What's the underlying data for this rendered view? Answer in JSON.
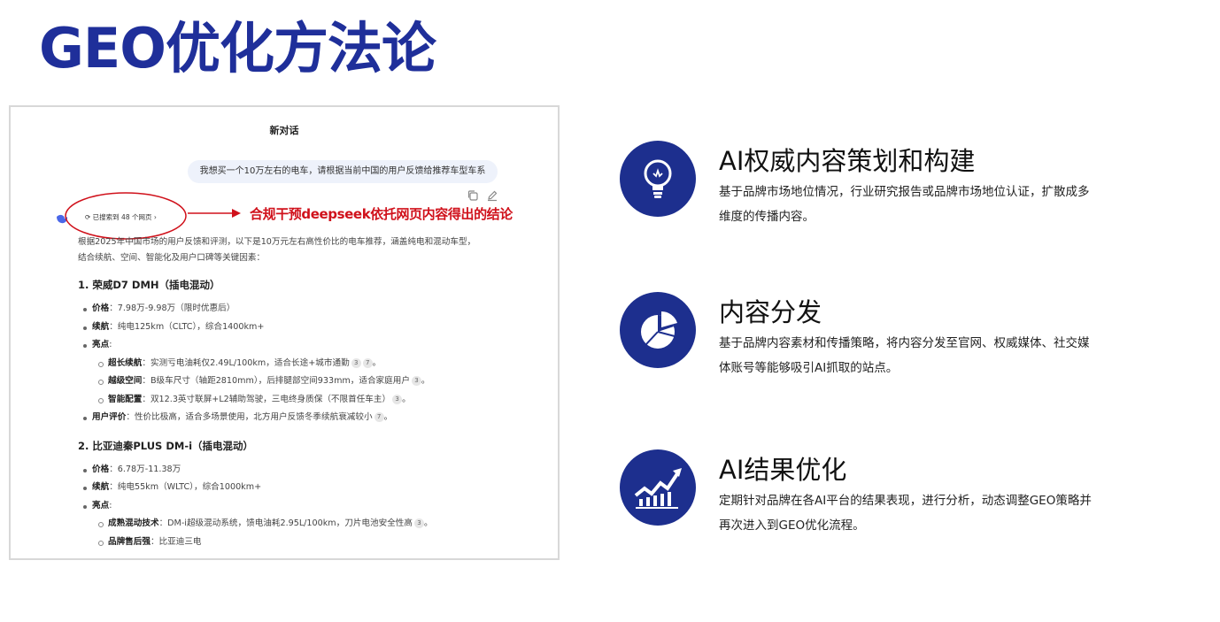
{
  "slide": {
    "title": "GEO优化方法论"
  },
  "chat": {
    "title": "新对话",
    "user_message": "我想买一个10万左右的电车，请根据当前中国的用户反馈给推荐车型车系",
    "search_chip": "已搜索到 48 个网页",
    "annotation": "合规干预deepseek依托网页内容得出的结论",
    "intro_line1": "根据2025年中国市场的用户反馈和评测，以下是10万元左右高性价比的电车推荐，涵盖纯电和混动车型，",
    "intro_line2": "结合续航、空间、智能化及用户口碑等关键因素：",
    "cars": [
      {
        "heading": "1. 荣威D7 DMH（插电混动）",
        "price_key": "价格",
        "price_val": "：7.98万-9.98万（限时优惠后）",
        "range_key": "续航",
        "range_val": "：纯电125km（CLTC），综合1400km+",
        "highlights_key": "亮点",
        "sub": [
          {
            "key": "超长续航",
            "val": "：实测亏电油耗仅2.49L/100km，适合长途+城市通勤",
            "cites": [
              "3",
              "7"
            ]
          },
          {
            "key": "越级空间",
            "val": "：B级车尺寸（轴距2810mm），后排腿部空间933mm，适合家庭用户",
            "cites": [
              "3"
            ]
          },
          {
            "key": "智能配置",
            "val": "：双12.3英寸联屏+L2辅助驾驶，三电终身质保（不限首任车主）",
            "cites": [
              "3"
            ]
          }
        ],
        "review_key": "用户评价",
        "review_val": "：性价比极高，适合多场景使用，北方用户反馈冬季续航衰减较小",
        "review_cites": [
          "7"
        ]
      },
      {
        "heading": "2. 比亚迪秦PLUS DM-i（插电混动）",
        "price_key": "价格",
        "price_val": "：6.78万-11.38万",
        "range_key": "续航",
        "range_val": "：纯电55km（WLTC），综合1000km+",
        "highlights_key": "亮点",
        "sub": [
          {
            "key": "成熟混动技术",
            "val": "：DM-i超级混动系统，馈电油耗2.95L/100km，刀片电池安全性高",
            "cites": [
              "3"
            ]
          },
          {
            "key": "品牌售后强",
            "val": "：比亚迪三电",
            "cites": []
          }
        ]
      }
    ]
  },
  "features": [
    {
      "icon": "lightbulb-icon",
      "title": "AI权威内容策划和构建",
      "desc_line1": "基于品牌市场地位情况，行业研究报告或品牌市场地位认证，扩散成多",
      "desc_line2": "维度的传播内容。"
    },
    {
      "icon": "pie-chart-icon",
      "title": "内容分发",
      "desc_line1": "基于品牌内容素材和传播策略，将内容分发至官网、权威媒体、社交媒",
      "desc_line2": "体账号等能够吸引AI抓取的站点。"
    },
    {
      "icon": "growth-chart-icon",
      "title": "AI结果优化",
      "desc_line1": "定期针对品牌在各AI平台的结果表现，进行分析，动态调整GEO策略并",
      "desc_line2": "再次进入到GEO优化流程。"
    }
  ],
  "colors": {
    "title_blue": "#1f2f9a",
    "icon_blue": "#1d2f8e",
    "annotation_red": "#d0111b"
  }
}
